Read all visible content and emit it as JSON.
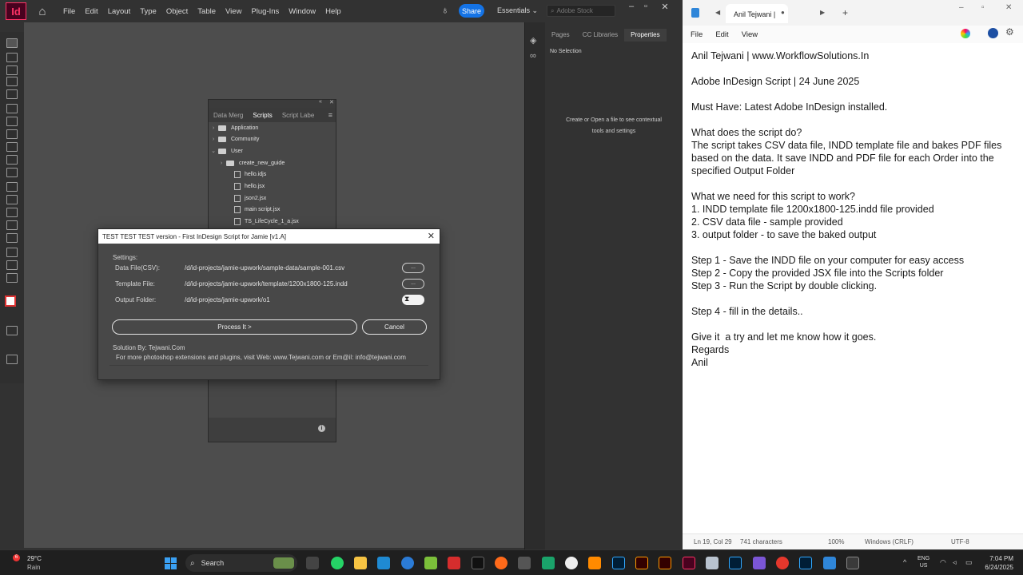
{
  "indesign": {
    "logo": "Id",
    "menu": [
      "File",
      "Edit",
      "Layout",
      "Type",
      "Object",
      "Table",
      "View",
      "Plug-Ins",
      "Window",
      "Help"
    ],
    "share_label": "Share",
    "workspace": "Essentials",
    "stock_placeholder": "Adobe Stock",
    "props_tabs": [
      "Pages",
      "CC Libraries",
      "Properties"
    ],
    "no_selection": "No Selection",
    "contextual_hint": "Create or Open a file to see contextual tools and settings",
    "scripts_panel": {
      "tabs": [
        "Data Merg",
        "Scripts",
        "Script Labe"
      ],
      "tree": [
        "Application",
        "Community",
        "User",
        "create_new_guide",
        "hello.idjs",
        "hello.jsx",
        "json2.jsx",
        "main script.jsx",
        "TS_LifeCycle_1_a.jsx"
      ]
    },
    "dialog": {
      "title": "TEST TEST TEST version - First InDesign Script for Jamie [v1.A]",
      "settings_label": "Settings:",
      "data_file_label": "Data File(CSV):",
      "data_file_value": "/d/id-projects/jamie-upwork/sample-data/sample-001.csv",
      "template_label": "Template File:",
      "template_value": "/d/id-projects/jamie-upwork/template/1200x1800-125.indd",
      "output_label": "Output Folder:",
      "output_value": "/d/id-projects/jamie-upwork/o1",
      "browse_label": "...",
      "process_label": "Process It >",
      "cancel_label": "Cancel",
      "solution_by": "Solution By: Tejwani.Com",
      "more_info": "For more photoshop extensions and plugins, visit  Web: www.Tejwani.com or Em@il: info@tejwani.com"
    }
  },
  "notepad": {
    "tab_title": "Anil Tejwani |",
    "menu": [
      "File",
      "Edit",
      "View"
    ],
    "text": "Anil Tejwani | www.WorkflowSolutions.In\n\nAdobe InDesign Script | 24 June 2025\n\nMust Have: Latest Adobe InDesign installed.\n\nWhat does the script do?\nThe script takes CSV data file, INDD template file and bakes PDF files based on the data. It save INDD and PDF file for each Order into the specified Output Folder\n\nWhat we need for this script to work?\n1. INDD template file 1200x1800-125.indd file provided\n2. CSV data file - sample provided\n3. output folder - to save the baked output\n\nStep 1 - Save the INDD file on your computer for easy access\nStep 2 - Copy the provided JSX file into the Scripts folder\nStep 3 - Run the Script by double clicking.\n\nStep 4 - fill in the details..\n\nGive it  a try and let me know how it goes.\nRegards\nAnil",
    "status": {
      "position": "Ln 19, Col 29",
      "chars": "741 characters",
      "zoom": "100%",
      "line_ending": "Windows (CRLF)",
      "encoding": "UTF-8"
    }
  },
  "taskbar": {
    "weather_badge": "6",
    "weather_temp": "29°C",
    "weather_cond": "Rain",
    "search_label": "Search",
    "lang_top": "ENG",
    "lang_bottom": "US",
    "time": "7:04 PM",
    "date": "6/24/2025"
  }
}
